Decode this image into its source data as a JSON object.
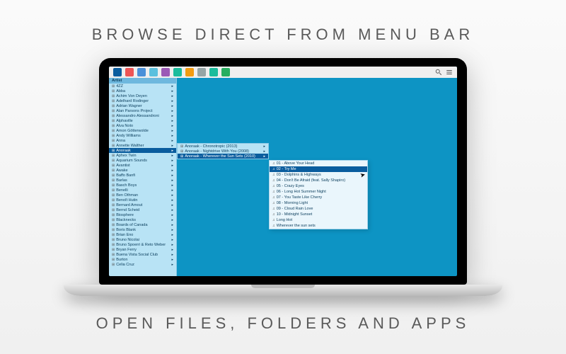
{
  "headlines": {
    "top": "BROWSE DIRECT FROM MENU BAR",
    "bottom": "OPEN FILES, FOLDERS AND APPS"
  },
  "menubar": {
    "active_icon": "app-icon",
    "icons": [
      "app-red",
      "app-blue",
      "app-cyan",
      "app-purple",
      "app-teal",
      "app-orange",
      "app-gray",
      "app-teal2",
      "app-green"
    ]
  },
  "columns": {
    "artists": {
      "header": "Artist",
      "selected_index": 13,
      "items": [
        "4ZZ",
        "Abba",
        "Achim Von Deyen",
        "Adelhard Rodinger",
        "Adrian Wagner",
        "Alan Parsons Project",
        "Alessandro Alessandroni",
        "Alphaville",
        "Alva Noto",
        "Amon Götterwolde",
        "Andy Williams",
        "Anna",
        "Annette Walther",
        "Anoraak",
        "Aphex Twin",
        "Aquarium Sounds",
        "Avantist",
        "Awake",
        "Baffo Banfi",
        "Barlas",
        "Basch Boys",
        "Benelli",
        "Ben Othman",
        "Benoît Hutin",
        "Bernard Arnout",
        "Bernd Scheid",
        "Biosphere",
        "Blacknecks",
        "Boards of Canada",
        "Boris Blank",
        "Brian Eno",
        "Bruno Nicolai",
        "Bruno Spoerri & Reto Weber",
        "Bryan Ferry",
        "Buena Vista Social Club",
        "Burton",
        "Celia Cruz"
      ]
    },
    "albums": {
      "selected_index": 2,
      "items": [
        "Anoraak - Chronotropic (2013)",
        "Anoraak - Nightdrive With You (2008)",
        "Anoraak - Wherever the Sun Sets (2010)"
      ]
    },
    "tracks": {
      "selected_index": 1,
      "items": [
        "01 - Above Your Head",
        "02 - Try Me",
        "03 - Dolphins & Highways",
        "04 - Don't Be Afraid (feat. Sally Shapiro)",
        "05 - Crazy Eyes",
        "06 - Long Hot Summer Night",
        "07 - You Taste Like Cherry",
        "08 - Morning Light",
        "09 - Cloud Rain Love",
        "10 - Midnight Sunset",
        "Long Hot",
        "Wherever the sun sets"
      ]
    }
  }
}
